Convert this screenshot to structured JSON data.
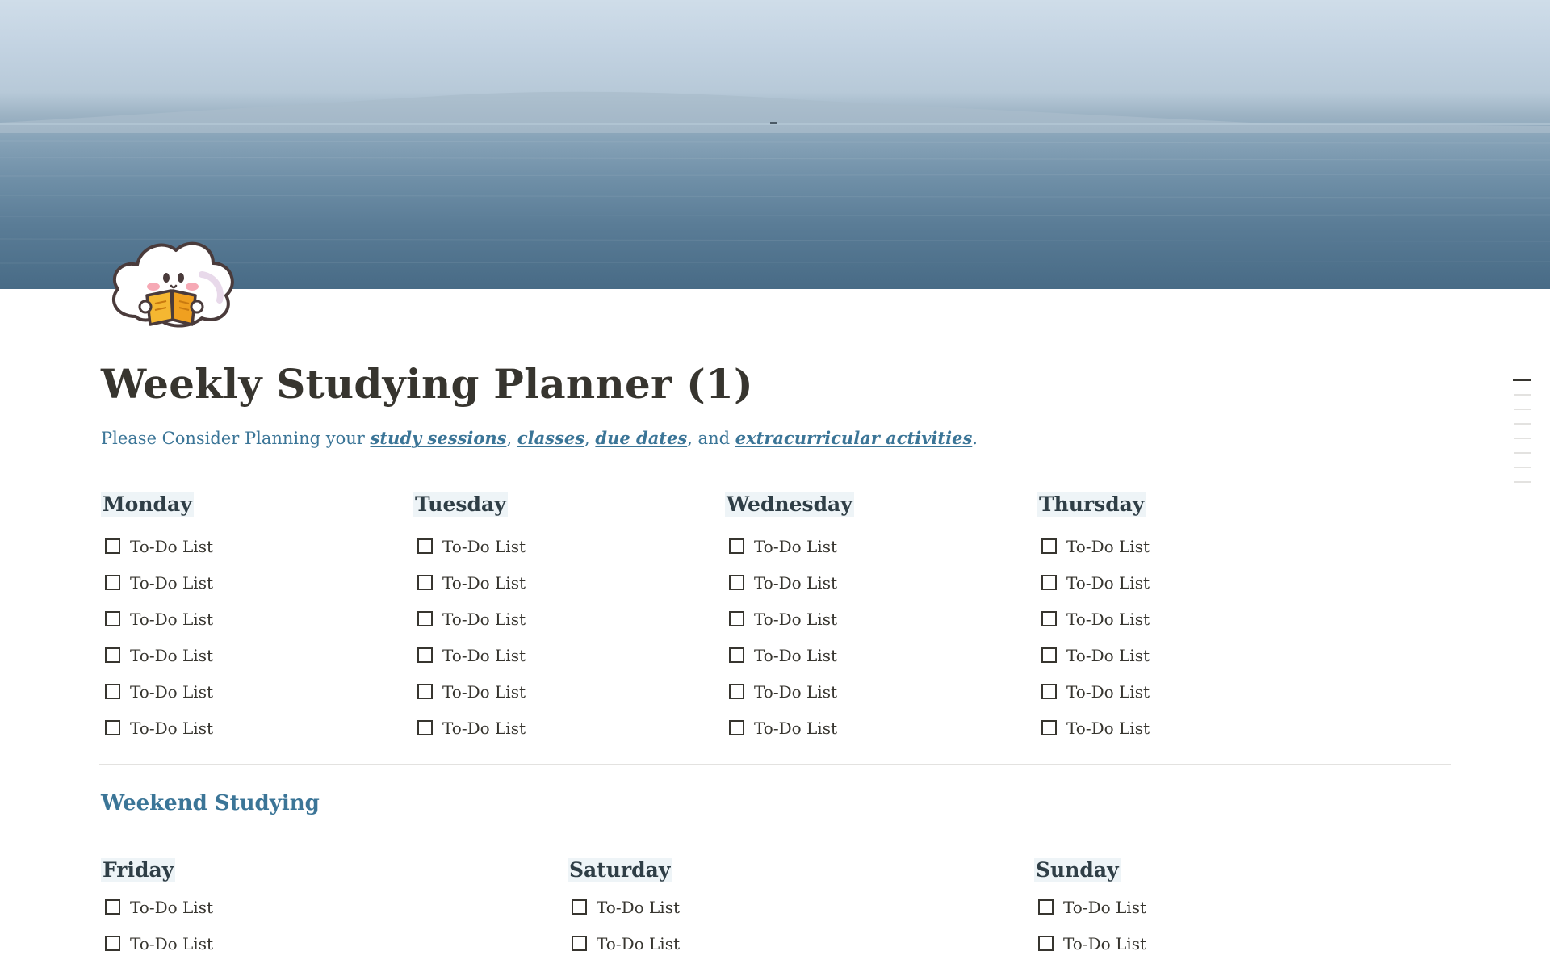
{
  "page": {
    "title": "Weekly Studying Planner (1)",
    "subtitle": {
      "prefix": "Please Consider Planning your",
      "link1": "study sessions",
      "sep1": ",",
      "link2": "classes",
      "sep2": ",",
      "link3": "due dates",
      "sep3": ", and",
      "link4": "extracurricular activities",
      "suffix": "."
    },
    "icon": "cloud-reading-book-icon"
  },
  "weekdays": [
    {
      "day": "Monday",
      "todos": [
        "To-Do List",
        "To-Do List",
        "To-Do List",
        "To-Do List",
        "To-Do List",
        "To-Do List"
      ]
    },
    {
      "day": "Tuesday",
      "todos": [
        "To-Do List",
        "To-Do List",
        "To-Do List",
        "To-Do List",
        "To-Do List",
        "To-Do List"
      ]
    },
    {
      "day": "Wednesday",
      "todos": [
        "To-Do List",
        "To-Do List",
        "To-Do List",
        "To-Do List",
        "To-Do List",
        "To-Do List"
      ]
    },
    {
      "day": "Thursday",
      "todos": [
        "To-Do List",
        "To-Do List",
        "To-Do List",
        "To-Do List",
        "To-Do List",
        "To-Do List"
      ]
    }
  ],
  "weekend": {
    "heading": "Weekend Studying",
    "days": [
      {
        "day": "Friday",
        "todos": [
          "To-Do List",
          "To-Do List"
        ]
      },
      {
        "day": "Saturday",
        "todos": [
          "To-Do List",
          "To-Do List"
        ]
      },
      {
        "day": "Sunday",
        "todos": [
          "To-Do List",
          "To-Do List"
        ]
      }
    ]
  },
  "colors": {
    "accent": "#3b7597",
    "text": "#37352f",
    "day_highlight": "#eef4f7"
  }
}
